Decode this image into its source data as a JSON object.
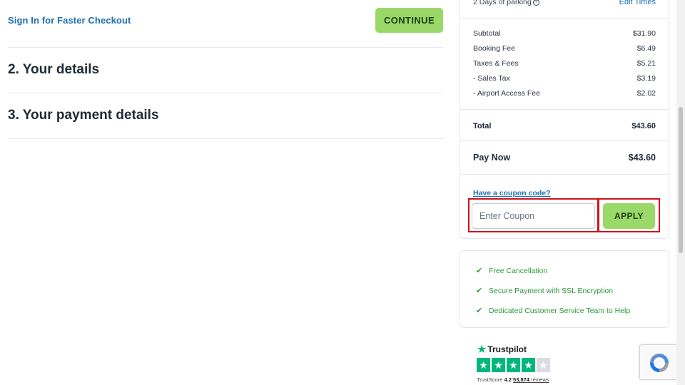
{
  "checkout": {
    "signin_link": "Sign In for Faster Checkout",
    "continue_label": "CONTINUE",
    "sections": [
      {
        "title": "2. Your details"
      },
      {
        "title": "3. Your payment details"
      }
    ]
  },
  "summary": {
    "parking_label": "2 Days of parking",
    "edit_times": "Edit Times",
    "fees": [
      {
        "label": "Subtotal",
        "amount": "$31.90"
      },
      {
        "label": "Booking Fee",
        "amount": "$6.49"
      },
      {
        "label": "Taxes & Fees",
        "amount": "$5.21"
      },
      {
        "label": "- Sales Tax",
        "amount": "$3.19"
      },
      {
        "label": "- Airport Access Fee",
        "amount": "$2.02"
      }
    ],
    "total_label": "Total",
    "total_amount": "$43.60",
    "paynow_label": "Pay Now",
    "paynow_amount": "$43.60",
    "coupon_link": "Have a coupon code?",
    "coupon_placeholder": "Enter Coupon",
    "apply_label": "APPLY"
  },
  "benefits": [
    "Free Cancellation",
    "Secure Payment with SSL Encryption",
    "Dedicated Customer Service Team to Help"
  ],
  "trustpilot": {
    "brand": "Trustpilot",
    "score_label": "TrustScore",
    "score": "4.2",
    "reviews_count": "53,874",
    "reviews_label": "reviews",
    "stars_filled": 4,
    "stars_total": 5
  },
  "colors": {
    "accent_green": "#9ad86a",
    "link_blue": "#1f6fb2",
    "check_green": "#2c9a3a",
    "highlight_red": "#d0121b",
    "trustpilot_green": "#00b67a"
  }
}
